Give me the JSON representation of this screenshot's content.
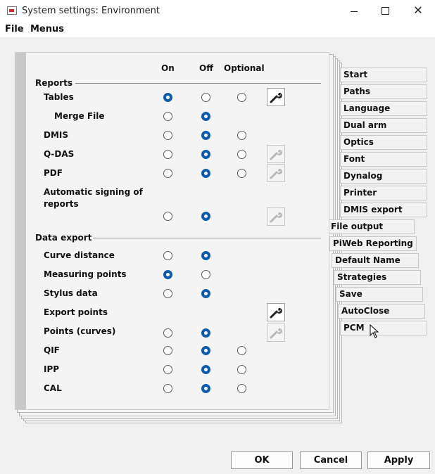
{
  "window": {
    "title": "System settings: Environment"
  },
  "menubar": {
    "file": "File",
    "menus": "Menus"
  },
  "columns": {
    "on": "On",
    "off": "Off",
    "optional": "Optional"
  },
  "reports": {
    "header": "Reports",
    "tables": "Tables",
    "merge_file": "Merge File",
    "dmis": "DMIS",
    "qdas": "Q-DAS",
    "pdf": "PDF",
    "auto_sign_1": "Automatic signing of",
    "auto_sign_2": "reports"
  },
  "export": {
    "header": "Data export",
    "curve_distance": "Curve distance",
    "measuring_points": "Measuring points",
    "stylus_data": "Stylus data",
    "export_points": "Export points",
    "points_curves": "Points (curves)",
    "qif": "QIF",
    "ipp": "IPP",
    "cal": "CAL"
  },
  "tabs": [
    "Start",
    "Paths",
    "Language",
    "Dual arm",
    "Optics",
    "Font",
    "Dynalog",
    "Printer",
    "DMIS export",
    "File output",
    "PiWeb Reporting",
    "Default Name",
    "Strategies",
    "Save",
    "AutoClose",
    "PCM"
  ],
  "buttons": {
    "ok": "OK",
    "cancel": "Cancel",
    "apply": "Apply"
  },
  "icons": {
    "tool": "wrench-icon",
    "close": "close-icon",
    "minimize": "minimize-icon",
    "maximize": "maximize-icon",
    "cursor": "mouse-cursor-icon"
  },
  "colors": {
    "radio_checked": "#0b5cad"
  }
}
